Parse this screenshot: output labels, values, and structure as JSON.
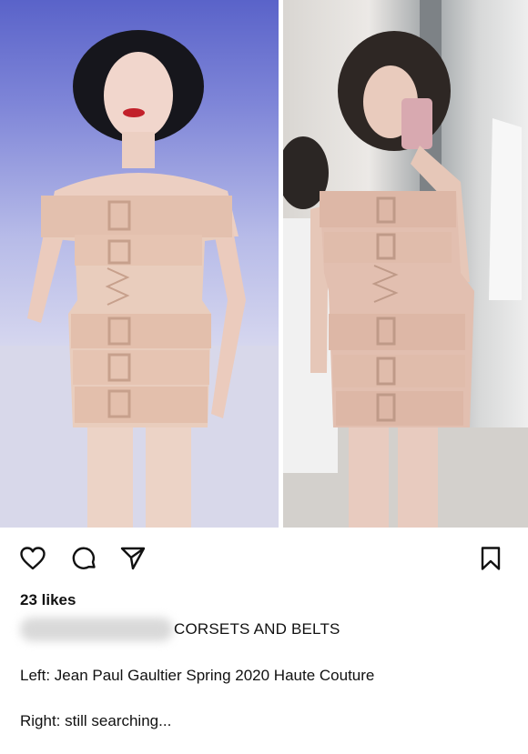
{
  "post": {
    "images": [
      {
        "name": "left-photo"
      },
      {
        "name": "right-photo"
      }
    ],
    "actions": {
      "like_icon": "heart-icon",
      "comment_icon": "comment-icon",
      "share_icon": "paper-plane-icon",
      "save_icon": "bookmark-icon"
    },
    "likes": "23 likes",
    "caption": {
      "heading": "CORSETS AND BELTS",
      "lines": [
        "Left: Jean Paul Gaultier Spring 2020 Haute Couture",
        "Right: still searching..."
      ]
    }
  },
  "colors": {
    "text": "#111111",
    "background": "#ffffff",
    "corset_pink": "#e8c8b8"
  }
}
